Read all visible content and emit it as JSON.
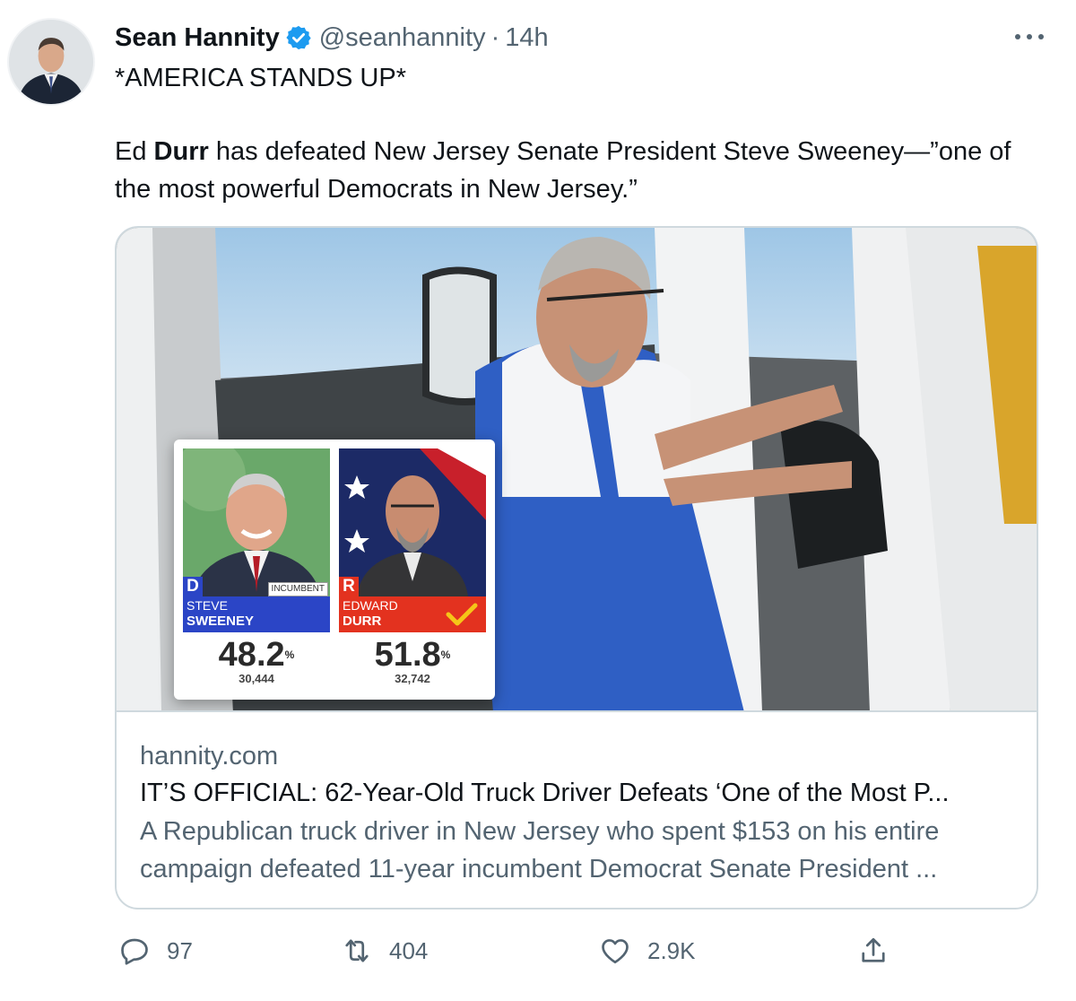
{
  "author": {
    "display_name": "Sean Hannity",
    "handle": "@seanhannity",
    "separator": "·",
    "time": "14h",
    "verified": true,
    "avatar_icon": "profile-photo"
  },
  "tweet": {
    "line1": "*AMERICA STANDS UP*",
    "para2_prefix": "Ed ",
    "para2_bold": "Durr",
    "para2_rest": " has defeated New Jersey Senate President Steve Sweeney—”one of the most powerful Democrats in New Jersey.”"
  },
  "card": {
    "domain": "hannity.com",
    "title": "IT’S OFFICIAL: 62-Year-Old Truck Driver Defeats ‘One of the Most P...",
    "description": "A Republican truck driver in New Jersey who spent $153 on his entire campaign defeated 11-year incumbent Democrat Senate President ...",
    "graphic": {
      "left": {
        "party": "D",
        "tag": "INCUMBENT",
        "first_name": "STEVE",
        "last_name": "SWEENEY",
        "percent": "48.2",
        "percent_sign": "%",
        "votes": "30,444",
        "color": "#2b45c6"
      },
      "right": {
        "party": "R",
        "first_name": "EDWARD",
        "last_name": "DURR",
        "percent": "51.8",
        "percent_sign": "%",
        "votes": "32,742",
        "color": "#e3321f",
        "winner_icon": "checkmark-icon"
      }
    }
  },
  "actions": {
    "replies": "97",
    "retweets": "404",
    "likes": "2.9K",
    "reply_icon": "reply-icon",
    "retweet_icon": "retweet-icon",
    "like_icon": "heart-icon",
    "share_icon": "share-icon"
  },
  "colors": {
    "verified": "#1d9bf0",
    "muted": "#536471",
    "text": "#0f1419",
    "border": "#cfd9de"
  }
}
